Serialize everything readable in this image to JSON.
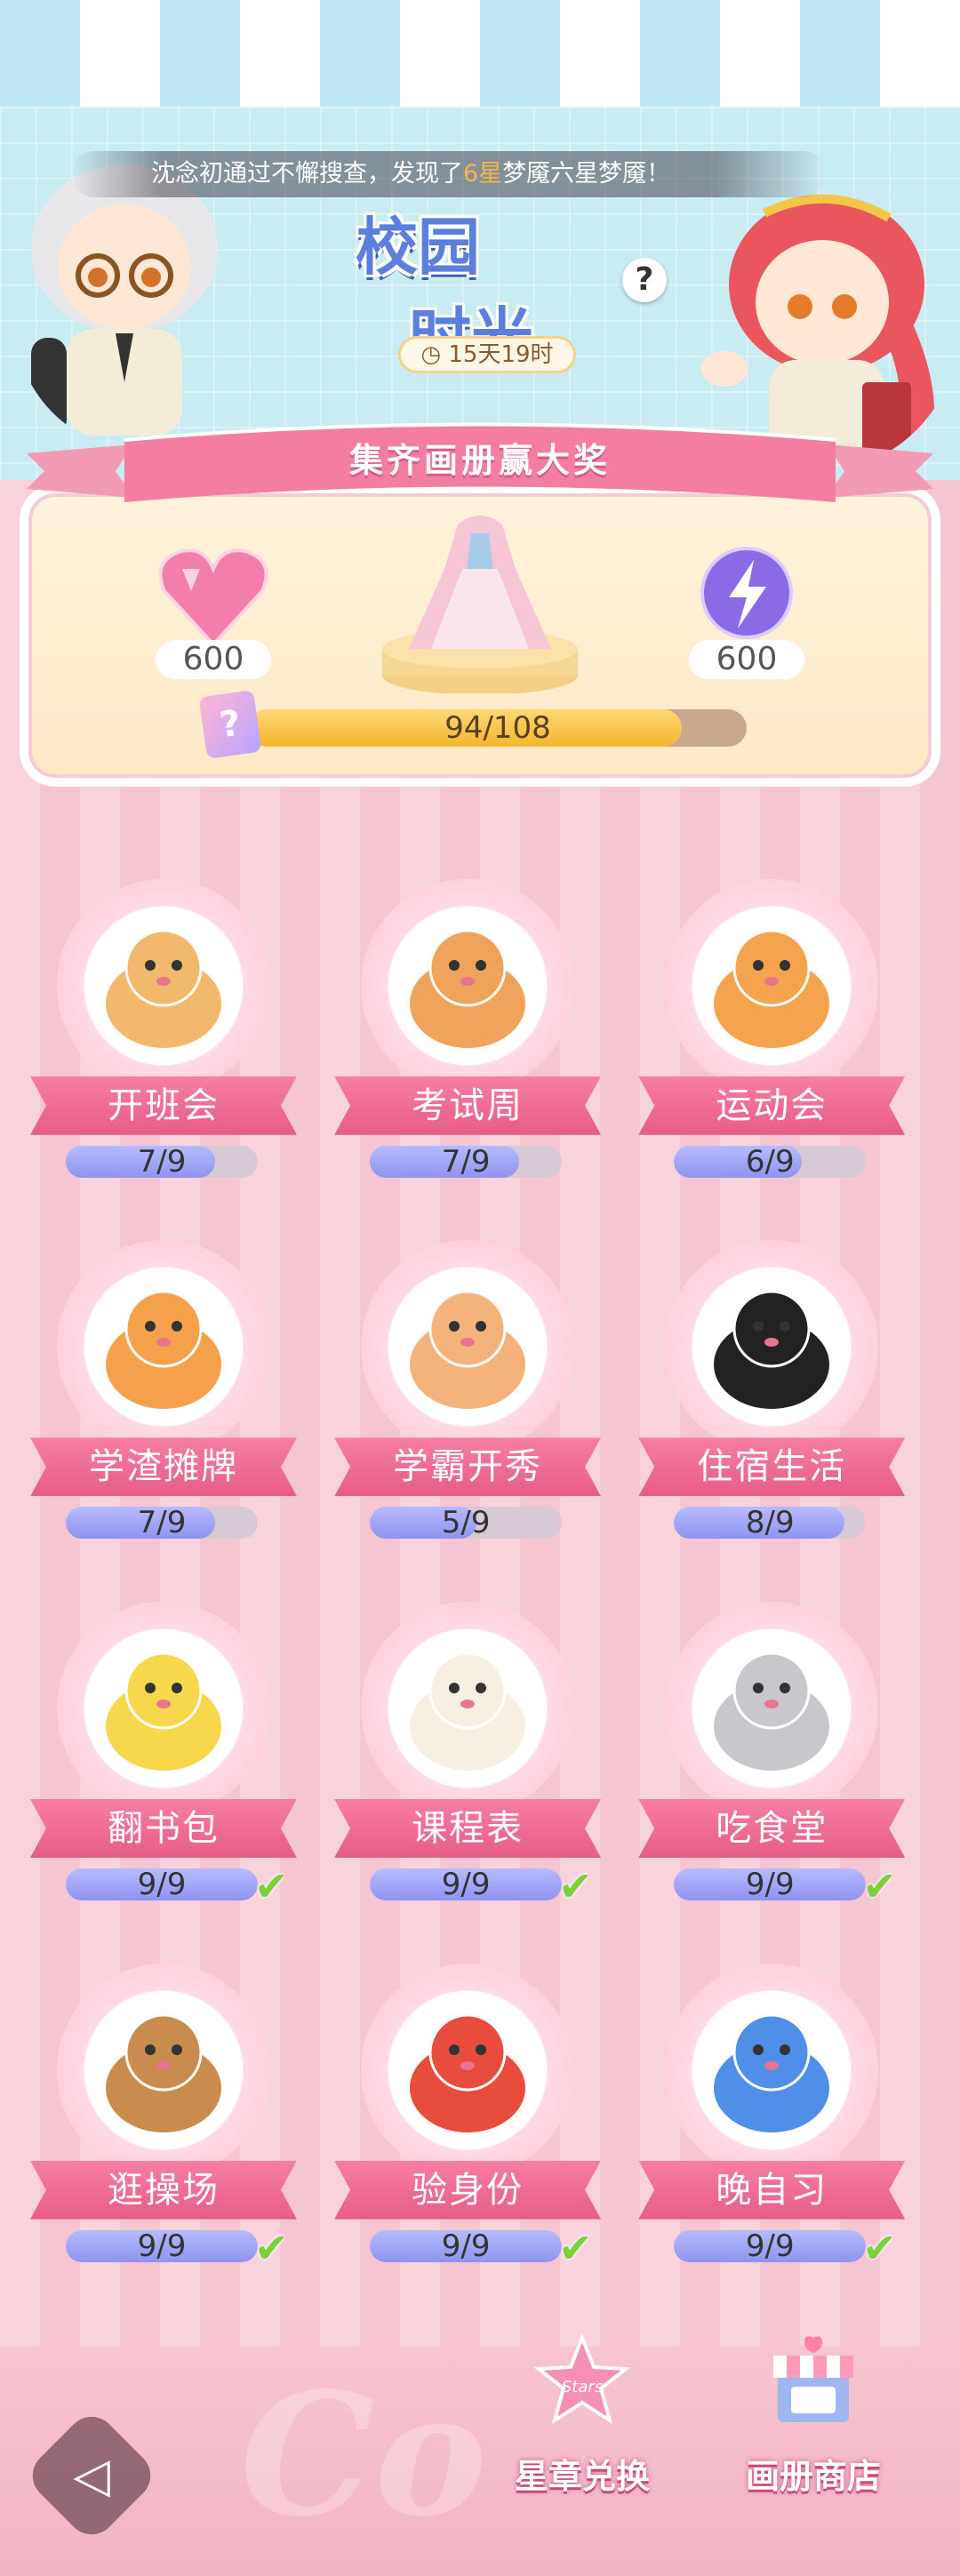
{
  "header": {
    "ticker_prefix": "沈念初通过不懈搜查，发现了",
    "ticker_highlight": "6星",
    "ticker_suffix": "梦魇六星梦魇！",
    "title_line1": "校园",
    "title_line2": "时光",
    "help_label": "?",
    "timer": "15天19时",
    "banner": "集齐画册赢大奖"
  },
  "prizes": {
    "left_amount": "600",
    "right_amount": "600",
    "progress_text": "94/108",
    "progress_fraction": 0.87,
    "card_icon_label": "?"
  },
  "albums": [
    {
      "name": "开班会",
      "progress": "7/9",
      "fraction": 0.778,
      "complete": false
    },
    {
      "name": "考试周",
      "progress": "7/9",
      "fraction": 0.778,
      "complete": false
    },
    {
      "name": "运动会",
      "progress": "6/9",
      "fraction": 0.667,
      "complete": false
    },
    {
      "name": "学渣摊牌",
      "progress": "7/9",
      "fraction": 0.778,
      "complete": false
    },
    {
      "name": "学霸开秀",
      "progress": "5/9",
      "fraction": 0.556,
      "complete": false
    },
    {
      "name": "住宿生活",
      "progress": "8/9",
      "fraction": 0.889,
      "complete": false
    },
    {
      "name": "翻书包",
      "progress": "9/9",
      "fraction": 1,
      "complete": true
    },
    {
      "name": "课程表",
      "progress": "9/9",
      "fraction": 1,
      "complete": true
    },
    {
      "name": "吃食堂",
      "progress": "9/9",
      "fraction": 1,
      "complete": true
    },
    {
      "name": "逛操场",
      "progress": "9/9",
      "fraction": 1,
      "complete": true
    },
    {
      "name": "验身份",
      "progress": "9/9",
      "fraction": 1,
      "complete": true
    },
    {
      "name": "晚自习",
      "progress": "9/9",
      "fraction": 1,
      "complete": true
    }
  ],
  "bottom": {
    "stars_exchange": "星章兑换",
    "stars_badge": "Stars",
    "album_shop": "画册商店",
    "check_mark": "✔",
    "back_glyph": "◁"
  }
}
